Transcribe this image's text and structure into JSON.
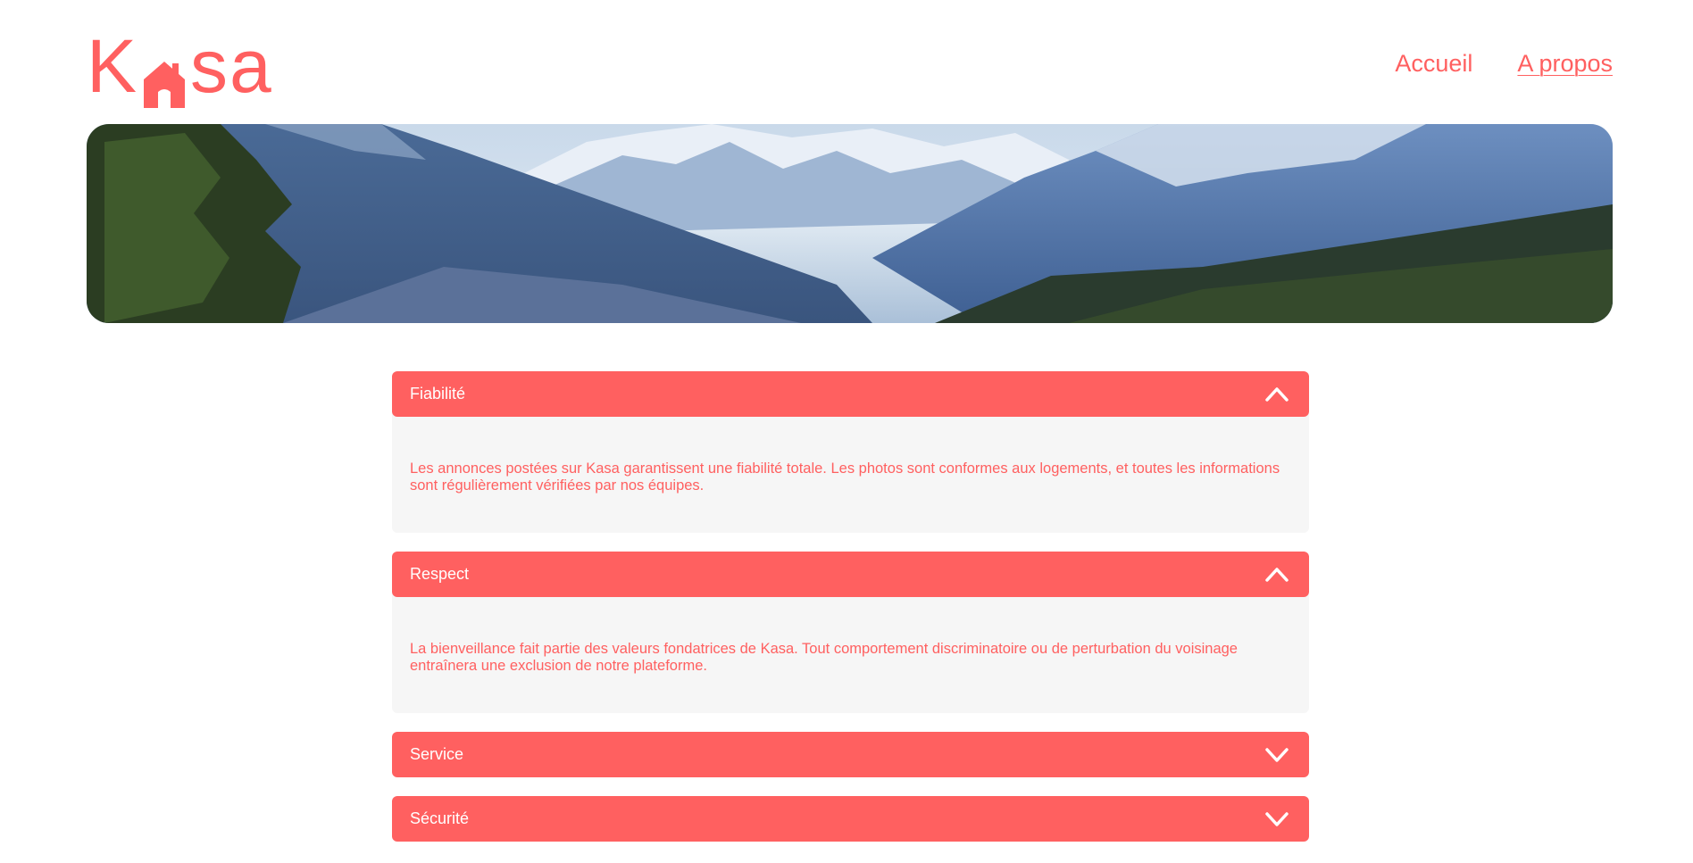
{
  "header": {
    "logo": {
      "letters_before": "K",
      "letters_after": "sa",
      "brand_color": "#FF6060",
      "icon": "house-icon"
    },
    "nav": [
      {
        "label": "Accueil",
        "active": false
      },
      {
        "label": "A propos",
        "active": true
      }
    ]
  },
  "banner": {
    "description_icon": "mountain-landscape-image"
  },
  "accordion": {
    "items": [
      {
        "title": "Fiabilité",
        "expanded": true,
        "chevron": "chevron-up-icon",
        "content": "Les annonces postées sur Kasa garantissent une fiabilité totale. Les photos sont conformes aux logements, et toutes les informations sont régulièrement vérifiées par nos équipes."
      },
      {
        "title": "Respect",
        "expanded": true,
        "chevron": "chevron-up-icon",
        "content": "La bienveillance fait partie des valeurs fondatrices de Kasa. Tout comportement discriminatoire ou de perturbation du voisinage entraînera une exclusion de notre plateforme."
      },
      {
        "title": "Service",
        "expanded": false,
        "chevron": "chevron-down-icon"
      },
      {
        "title": "Sécurité",
        "expanded": false,
        "chevron": "chevron-down-icon"
      }
    ]
  },
  "colors": {
    "accent": "#FF6060",
    "panel": "#F6F6F6",
    "text_on_accent": "#FFFFFF"
  }
}
